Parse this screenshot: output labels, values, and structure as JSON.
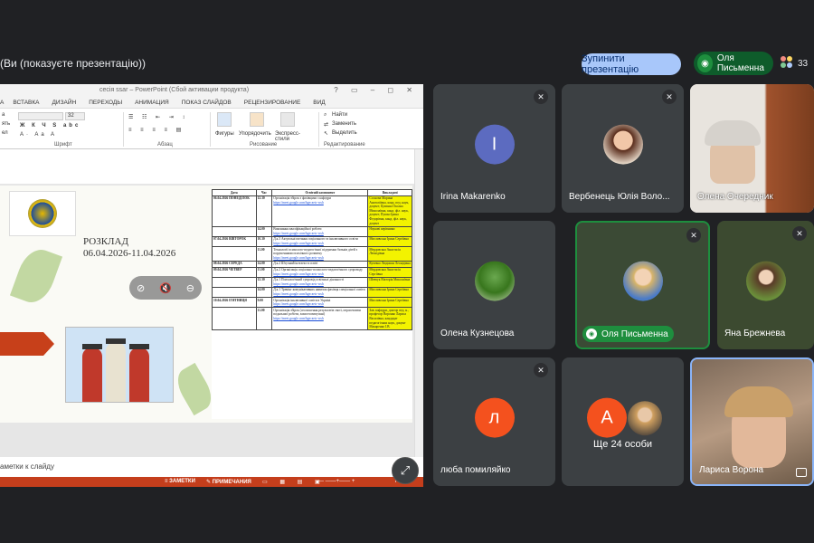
{
  "topbar": {
    "presenting_label": "(Ви (показуєте презентацію))",
    "stop_button": "Зупинити презентацію",
    "active_speaker": "Оля Письменна",
    "participant_count": "33"
  },
  "ppt": {
    "title": "сесія ssar – PowerPoint (Сбой активации продукта)",
    "window_controls": "? ▭ – ◻ ✕",
    "tabs": [
      "А",
      "ВСТАВКА",
      "ДИЗАЙН",
      "ПЕРЕХОДЫ",
      "АНИМАЦИЯ",
      "ПОКАЗ СЛАЙДОВ",
      "РЕЦЕНЗИРОВАНИЕ",
      "ВИД"
    ],
    "ribbon_groups": [
      "Шрифт",
      "Абзац",
      "Рисование",
      "Редактирование"
    ],
    "ribbon_items": {
      "font_size": "32",
      "shapes": "Фигуры",
      "arrange": "Упорядочить",
      "express_styles": "Экспресс-стили",
      "find": "Найти",
      "replace": "Заменить",
      "select": "Выделить",
      "left_a": "а",
      "left_b": "ять",
      "left_c": "ел"
    },
    "notes_label": "аметки к слайду",
    "status_notes": "ЗАМЕТКИ",
    "status_comments": "ПРИМЕЧАНИЯ",
    "zoom": "70"
  },
  "slide": {
    "schedule_title": "РОЗКЛАД",
    "schedule_dates": "06.04.2026-11.04.2026",
    "table_headers": [
      "Дата",
      "Час",
      "Освітній компонент",
      "Викладачі"
    ],
    "rows": [
      {
        "date": "06.04.2026 ПОНЕДІЛОК",
        "time": "12.30",
        "topic": "Організація збірок з фахівцями з кафедри",
        "link": "https://meet.google.com/bgn-aetc-wxh",
        "teacher": "Соснова Марина Анатоліївна, канд. пед. наук, доцент; Цілинна Оксана Миколаївна, канд. філ. наук, доцент; Пушко Ірина Федорівна, канд. філ. наук, доцент"
      },
      {
        "date": "",
        "time": "14.00",
        "topic": "Виконання кваліфікаційної роботи",
        "link": "https://meet.google.com/bgn-aetc-wxh",
        "teacher": "Наукові керівники"
      },
      {
        "date": "07.04.2026 ВІВТОРОК",
        "time": "10.30",
        "topic": "Д.к.3 Актуальні питання соціального та інклюзивного освіти",
        "link": "https://meet.google.com/bgn-aetc-wxh",
        "teacher": "Мисливська Ірина Сергіївна"
      },
      {
        "date": "",
        "time": "11.00",
        "topic": "Технології психолого-педагогічної підтримки батьків дітей з порушеннями психічного розвитку",
        "link": "https://meet.google.com/bgn-aetc-wxh",
        "teacher": "Мердовська Анастасія Леонідівна"
      },
      {
        "date": "08.04.2026 СЕРЕДА",
        "time": "14.00",
        "topic": "Д.к.2 Штучний інтелект в освіті",
        "link": "",
        "teacher": "Кучевко Людмила Леонідівна"
      },
      {
        "date": "09.04.2026 ЧЕТВЕР",
        "time": "11.00",
        "topic": "Д.к.2 Організація соціально-психолого-педагогічного супроводу",
        "link": "https://meet.google.com/bgn-aetc-wxh",
        "teacher": "Мердовська Анастасія Сергіївна"
      },
      {
        "date": "",
        "time": "12.30",
        "topic": "Д.к.1 Психологічний супровід освітньої діяльності",
        "link": "https://meet.google.com/bgn-aetc-wxh",
        "teacher": "Шевчук Вікторія Миколаївна"
      },
      {
        "date": "",
        "time": "14.00",
        "topic": "Д.к.1 Тренінг комунікативних навичок фахівця спеціальної освіти",
        "link": "https://meet.google.com/bgn-aetc-wxh",
        "teacher": "Мисливська Ірина Сергіївна"
      },
      {
        "date": "10.04.2026 П'ЯТНИЦЯ",
        "time": "9.00",
        "topic": "Організація інклюзивної освіти в Україні",
        "link": "https://meet.google.com/bgn-aetc-wxh",
        "teacher": "Мисливська Ірина Сергіївна"
      },
      {
        "date": "",
        "time": "11.00",
        "topic": "Організація збірок (оголошення результатів своєї, перспективи подальшої роботи, захисти випускні)",
        "link": "https://meet.google.com/bgn-aetc-wxh",
        "teacher": "Зав. кафедри, доктор пед. н., професор Воронко Лариса Василівна, кандидат педагогічних наук, доцент Макаренко І.В."
      }
    ]
  },
  "tiles": [
    {
      "name": "",
      "initial": ""
    },
    {
      "name": "Irina Makarenko",
      "initial": "I"
    },
    {
      "name": "Вербенець Юлія Воло...",
      "initial": ""
    },
    {
      "name": "Олена Очередник",
      "initial": ""
    },
    {
      "name": "Олена Кузнецова",
      "initial": ""
    },
    {
      "name": "Оля Письменна",
      "initial": ""
    },
    {
      "name": "Яна Брежнева",
      "initial": ""
    },
    {
      "name": "люба помиляйко",
      "initial": "л"
    },
    {
      "name": "Ще 24 особи",
      "initial": "А"
    },
    {
      "name": "Лариса Ворона",
      "initial": ""
    }
  ],
  "colors": {
    "meet_bg": "#202124",
    "tile_bg": "#3c4043",
    "stop_btn": "#a8c7fa",
    "speaking": "#1e8e3e",
    "ppt_status": "#c43e1c",
    "irina_avatar": "#5c6bc0",
    "orange_avatar": "#f4511e"
  }
}
